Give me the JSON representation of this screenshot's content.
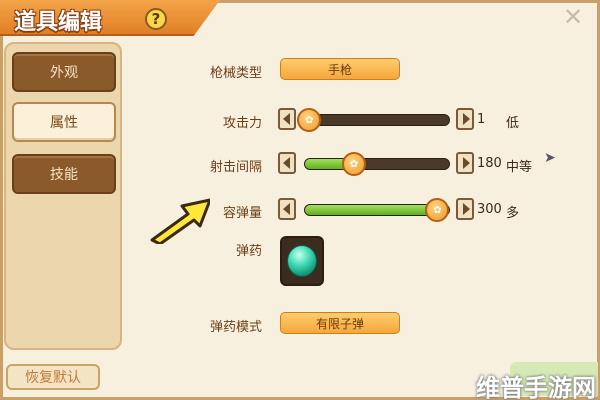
{
  "title": "道具编辑",
  "help_icon": "?",
  "close_icon": "✕",
  "tabs": [
    {
      "label": "外观",
      "active": false
    },
    {
      "label": "属性",
      "active": true
    },
    {
      "label": "技能",
      "active": false
    }
  ],
  "restore_label": "恢复默认",
  "weapon_type": {
    "label": "枪械类型",
    "value": "手枪"
  },
  "attack": {
    "label": "攻击力",
    "value": "1",
    "level": "低",
    "fraction": 0.03
  },
  "interval": {
    "label": "射击间隔",
    "value": "180",
    "level": "中等",
    "fraction": 0.34
  },
  "capacity": {
    "label": "容弹量",
    "value": "300",
    "level": "多",
    "fraction": 0.92
  },
  "ammo": {
    "label": "弹药",
    "icon": "green-gem-icon"
  },
  "ammo_mode": {
    "label": "弹药模式",
    "value": "有限子弹"
  },
  "watermark": "维普手游网",
  "colors": {
    "accent": "#f4a63b",
    "title_bar": "#e07f25",
    "slider_fill": "#5fb022"
  }
}
